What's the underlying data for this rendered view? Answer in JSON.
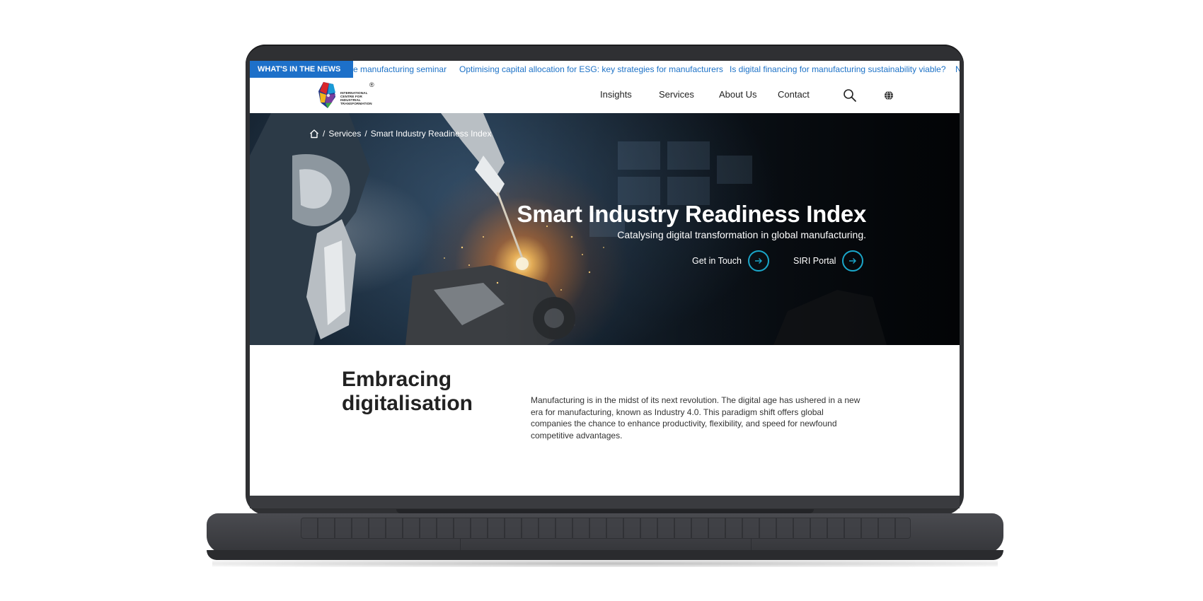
{
  "ticker": {
    "label": "WHAT'S IN THE NEWS",
    "items": [
      "e manufacturing seminar",
      "Optimising capital allocation for ESG: key strategies for manufacturers",
      "Is digital financing for manufacturing sustainability viable?",
      "N"
    ]
  },
  "logo": {
    "lines": [
      "INTERNATIONAL",
      "CENTRE FOR",
      "INDUSTRIAL",
      "TRANSFORMATION"
    ],
    "reg_mark": "®"
  },
  "nav": {
    "items": [
      "Insights",
      "Services",
      "About Us",
      "Contact"
    ],
    "icons": [
      "search-icon",
      "globe-icon"
    ]
  },
  "breadcrumb": {
    "items": [
      "Services",
      "Smart Industry Readiness Index"
    ],
    "separator": "/"
  },
  "hero": {
    "title": "Smart Industry Readiness Index",
    "subtitle": "Catalysing digital transformation in global manufacturing.",
    "cta_primary": "Get in Touch",
    "cta_secondary": "SIRI Portal"
  },
  "intro": {
    "title": "Embracing digitalisation",
    "text": "Manufacturing is in the midst of its next revolution. The digital age has ushered in a new era for manufacturing, known as Industry 4.0. This paradigm shift offers global companies the chance to enhance productivity, flexibility, and speed for newfound competitive advantages."
  },
  "colors": {
    "accent": "#1d70c9",
    "cta_ring": "#1aa6c9",
    "laptop_body": "#2f3033"
  }
}
